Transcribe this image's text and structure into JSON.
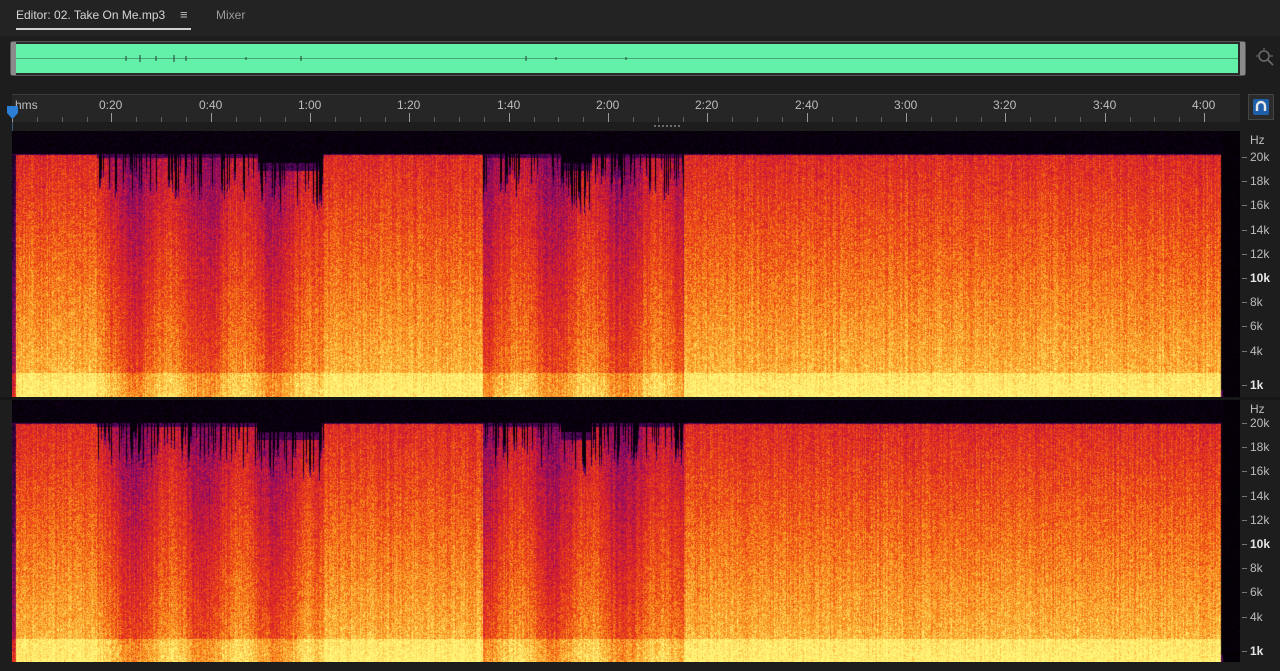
{
  "tabs": {
    "editor_label": "Editor: 02. Take On Me.mp3",
    "menu_glyph": "≡",
    "mixer_label": "Mixer"
  },
  "overview": {
    "waveform_color": "#63f0a9"
  },
  "ruler": {
    "unit_label": "hms",
    "labels": [
      "0:20",
      "0:40",
      "1:00",
      "1:20",
      "1:40",
      "2:00",
      "2:20",
      "2:40",
      "3:00",
      "3:20",
      "3:40",
      "4:00"
    ],
    "label_seconds": [
      20,
      40,
      60,
      80,
      100,
      120,
      140,
      160,
      180,
      200,
      220,
      240
    ],
    "duration_seconds": 244
  },
  "frequency_axis": {
    "unit": "Hz",
    "labels": [
      "20k",
      "18k",
      "16k",
      "14k",
      "12k",
      "10k",
      "8k",
      "6k",
      "4k",
      "1k"
    ],
    "label_hz": [
      20000,
      18000,
      16000,
      14000,
      12000,
      10000,
      8000,
      6000,
      4000,
      1000
    ],
    "emphasized": [
      "10k",
      "1k"
    ]
  },
  "channels": [
    "left",
    "right"
  ],
  "colors": {
    "accent": "#1f5ea8",
    "playhead": "#2d7fd6"
  },
  "icons": {
    "zoom": "zoom-magnifier-icon",
    "snap": "snap-magnet-icon",
    "playhead": "playhead-marker-icon"
  }
}
